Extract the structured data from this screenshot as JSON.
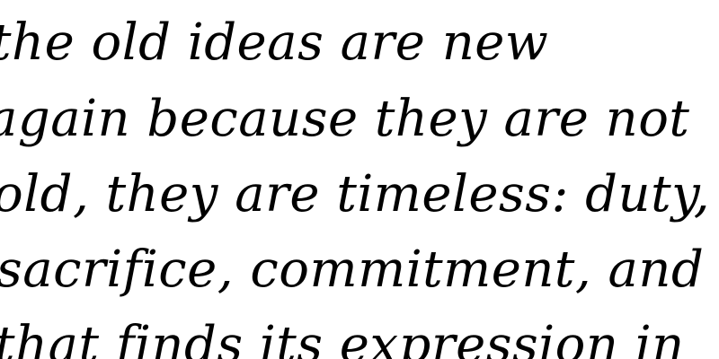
{
  "text": {
    "lines": [
      "the old ideas are new",
      "again because they are not",
      "old, they are timeless: duty,",
      "sacrifice, commitment, and a",
      "that finds its expression in"
    ]
  }
}
